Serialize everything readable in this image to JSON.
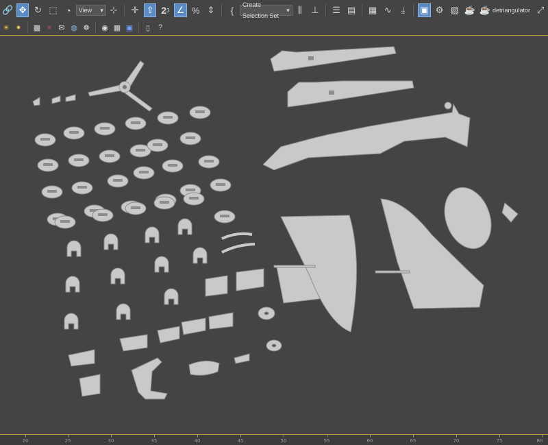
{
  "toolbar_main": {
    "view_dropdown": "View",
    "selection_set_dropdown": "Create Selection Set",
    "script_label": "detriangulator",
    "snap_label": "2",
    "snap_sub": "3",
    "icons": [
      "link-icon",
      "move-icon",
      "rotate-icon",
      "scale-icon",
      "select-region-icon",
      "pivot-icon",
      "snap-icon",
      "angle-snap-icon",
      "percent-snap-icon",
      "spinner-snap-icon",
      "edit-named-icon",
      "mirror-icon",
      "align-icon",
      "layer-icon",
      "scene-explorer-icon",
      "curve-editor-icon",
      "schematic-icon",
      "material-editor-icon",
      "render-setup-icon",
      "render-frame-icon",
      "render-icon"
    ]
  },
  "toolbar_secondary": {
    "icons": [
      "light-icon",
      "sphere-icon",
      "texture-icon",
      "molecule-icon",
      "paint-icon",
      "globe-icon",
      "material-ball-icon",
      "shader-icon",
      "container-icon",
      "help-icon"
    ]
  },
  "ruler": {
    "labels": [
      "20",
      "25",
      "30",
      "35",
      "40",
      "45",
      "50",
      "55",
      "60",
      "65",
      "70",
      "75",
      "80"
    ]
  },
  "colors": {
    "background": "#444444",
    "piece": "#c9c9c9",
    "piece_edge": "#8d8d8d",
    "accent": "#5b8bc4",
    "frame": "#c9a24a"
  }
}
